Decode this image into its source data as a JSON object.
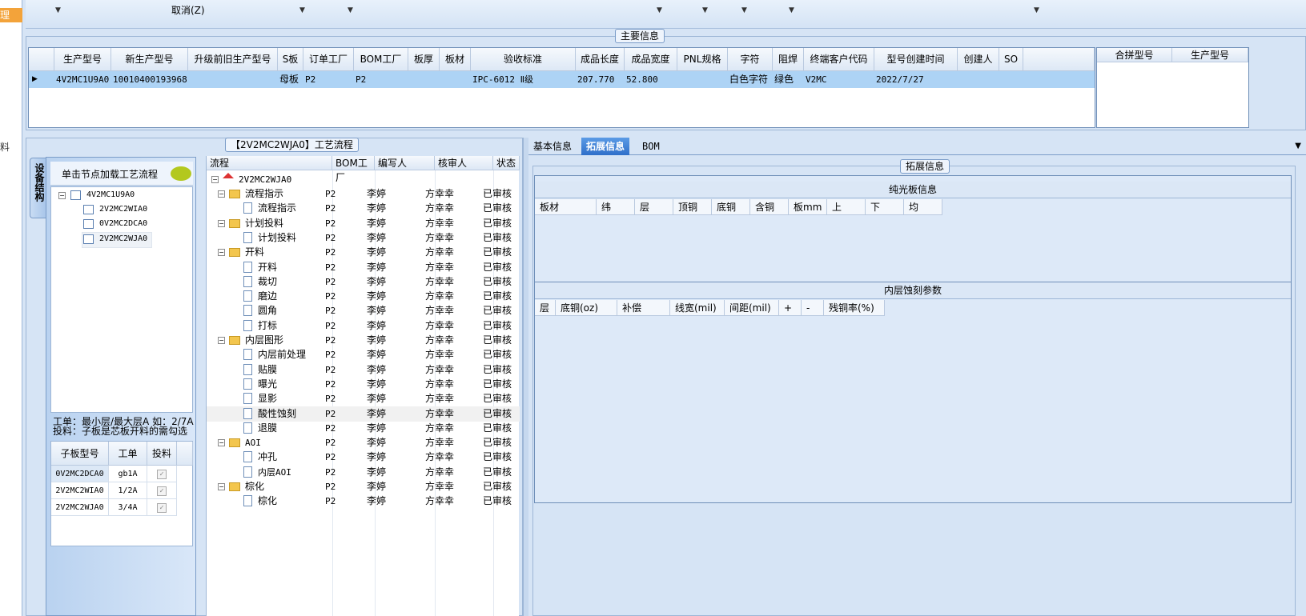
{
  "left_strip": {
    "highlight_text": "理",
    "side_text": "料"
  },
  "toolbar": {
    "cancel_label": "取消(Z)"
  },
  "main_info": {
    "title": "主要信息",
    "columns": [
      "生产型号",
      "新生产型号",
      "升级前旧生产型号",
      "S板",
      "订单工厂",
      "BOM工厂",
      "板厚",
      "板材",
      "验收标准",
      "成品长度",
      "成品宽度",
      "PNL规格",
      "字符",
      "阻焊",
      "终端客户代码",
      "型号创建时间",
      "创建人",
      "SO"
    ],
    "row": [
      "4V2MC1U9A0",
      "10010400193968",
      "",
      "母板",
      "P2",
      "P2",
      "",
      "",
      "IPC-6012 Ⅱ级",
      "207.770",
      "52.800",
      "",
      "白色字符",
      "绿色",
      "V2MC",
      "2022/7/27",
      "",
      ""
    ],
    "merge_columns": [
      "合拼型号",
      "生产型号"
    ]
  },
  "flow_group": {
    "title": "【2V2MC2WJA0】工艺流程"
  },
  "side_tab": {
    "label": "设备结构"
  },
  "hint": {
    "text": "单击节点加载工艺流程"
  },
  "tree1": {
    "root": "4V2MC1U9A0",
    "children": [
      "2V2MC2WIA0",
      "0V2MC2DCA0",
      "2V2MC2WJA0"
    ]
  },
  "note": {
    "line1": "工单：最小层/最大层A 如：2/7A",
    "line2": "投料：子板是芯板开料的需勾选"
  },
  "subgrid": {
    "columns": [
      "子板型号",
      "工单",
      "投料"
    ],
    "rows": [
      {
        "model": "0V2MC2DCA0",
        "order": "gb1A",
        "checked": true
      },
      {
        "model": "2V2MC2WIA0",
        "order": "1/2A",
        "checked": true
      },
      {
        "model": "2V2MC2WJA0",
        "order": "3/4A",
        "checked": true
      }
    ]
  },
  "flow_grid": {
    "columns": [
      "流程",
      "BOM工厂",
      "编写人",
      "核审人",
      "状态"
    ],
    "root": "2V2MC2WJA0",
    "rows": [
      {
        "name": "流程指示",
        "level": 1,
        "factory": "P2",
        "writer": "李婷",
        "reviewer": "方幸幸",
        "status": "已审核"
      },
      {
        "name": "流程指示",
        "level": 2,
        "factory": "P2",
        "writer": "李婷",
        "reviewer": "方幸幸",
        "status": "已审核"
      },
      {
        "name": "计划投料",
        "level": 1,
        "factory": "P2",
        "writer": "李婷",
        "reviewer": "方幸幸",
        "status": "已审核"
      },
      {
        "name": "计划投料",
        "level": 2,
        "factory": "P2",
        "writer": "李婷",
        "reviewer": "方幸幸",
        "status": "已审核"
      },
      {
        "name": "开料",
        "level": 1,
        "factory": "P2",
        "writer": "李婷",
        "reviewer": "方幸幸",
        "status": "已审核"
      },
      {
        "name": "开料",
        "level": 2,
        "factory": "P2",
        "writer": "李婷",
        "reviewer": "方幸幸",
        "status": "已审核"
      },
      {
        "name": "裁切",
        "level": 2,
        "factory": "P2",
        "writer": "李婷",
        "reviewer": "方幸幸",
        "status": "已审核"
      },
      {
        "name": "磨边",
        "level": 2,
        "factory": "P2",
        "writer": "李婷",
        "reviewer": "方幸幸",
        "status": "已审核"
      },
      {
        "name": "圆角",
        "level": 2,
        "factory": "P2",
        "writer": "李婷",
        "reviewer": "方幸幸",
        "status": "已审核"
      },
      {
        "name": "打标",
        "level": 2,
        "factory": "P2",
        "writer": "李婷",
        "reviewer": "方幸幸",
        "status": "已审核"
      },
      {
        "name": "内层图形",
        "level": 1,
        "factory": "P2",
        "writer": "李婷",
        "reviewer": "方幸幸",
        "status": "已审核"
      },
      {
        "name": "内层前处理",
        "level": 2,
        "factory": "P2",
        "writer": "李婷",
        "reviewer": "方幸幸",
        "status": "已审核"
      },
      {
        "name": "贴膜",
        "level": 2,
        "factory": "P2",
        "writer": "李婷",
        "reviewer": "方幸幸",
        "status": "已审核"
      },
      {
        "name": "曝光",
        "level": 2,
        "factory": "P2",
        "writer": "李婷",
        "reviewer": "方幸幸",
        "status": "已审核"
      },
      {
        "name": "显影",
        "level": 2,
        "factory": "P2",
        "writer": "李婷",
        "reviewer": "方幸幸",
        "status": "已审核"
      },
      {
        "name": "酸性蚀刻",
        "level": 2,
        "factory": "P2",
        "writer": "李婷",
        "reviewer": "方幸幸",
        "status": "已审核"
      },
      {
        "name": "退膜",
        "level": 2,
        "factory": "P2",
        "writer": "李婷",
        "reviewer": "方幸幸",
        "status": "已审核"
      },
      {
        "name": "AOI",
        "level": 1,
        "factory": "P2",
        "writer": "李婷",
        "reviewer": "方幸幸",
        "status": "已审核"
      },
      {
        "name": "冲孔",
        "level": 2,
        "factory": "P2",
        "writer": "李婷",
        "reviewer": "方幸幸",
        "status": "已审核"
      },
      {
        "name": "内层AOI",
        "level": 2,
        "factory": "P2",
        "writer": "李婷",
        "reviewer": "方幸幸",
        "status": "已审核"
      },
      {
        "name": "棕化",
        "level": 1,
        "factory": "P2",
        "writer": "李婷",
        "reviewer": "方幸幸",
        "status": "已审核"
      },
      {
        "name": "棕化",
        "level": 2,
        "factory": "P2",
        "writer": "李婷",
        "reviewer": "方幸幸",
        "status": "已审核"
      }
    ]
  },
  "right_tabs": {
    "tabs": [
      "基本信息",
      "拓展信息",
      "BOM"
    ],
    "active": "拓展信息"
  },
  "ext_info": {
    "title": "拓展信息",
    "section1": {
      "title": "纯光板信息",
      "columns": [
        "板材",
        "纬",
        "层",
        "顶铜",
        "底铜",
        "含铜",
        "板mm",
        "上",
        "下",
        "均"
      ]
    },
    "section2": {
      "title": "内层蚀刻参数",
      "columns": [
        "层",
        "底铜(oz)",
        "补偿",
        "线宽(mil)",
        "间距(mil)",
        "+",
        "-",
        "残铜率(%)"
      ]
    }
  }
}
